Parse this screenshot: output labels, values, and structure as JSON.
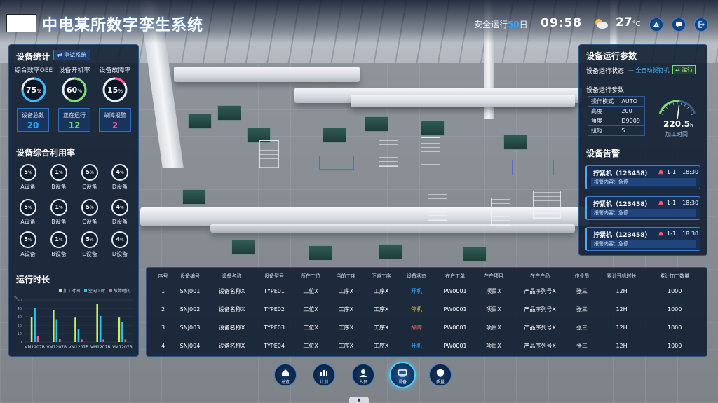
{
  "header": {
    "title": "中电某所数字孪生系统",
    "safe_prefix": "安全运行",
    "safe_days": "50",
    "safe_suffix": "日",
    "time": "09:58",
    "temperature": "27",
    "temp_unit": "°C",
    "buttons": [
      "alert-icon",
      "chat-icon",
      "logout-icon"
    ]
  },
  "stats": {
    "title": "设备统计",
    "tag": "测试系统",
    "metrics": [
      {
        "label": "综合效率OEE",
        "value": 75,
        "unit": "%",
        "color": "#3fb6ff"
      },
      {
        "label": "设备开机率",
        "value": 60,
        "unit": "%",
        "color": "#7ee06a"
      },
      {
        "label": "设备故障率",
        "value": 15,
        "unit": "%",
        "color": "#ff5d8f"
      }
    ],
    "boxes": [
      {
        "label": "设备总数",
        "value": "20",
        "color": "#2ea8ff"
      },
      {
        "label": "正在运行",
        "value": "12",
        "color": "#6de36a"
      },
      {
        "label": "故障报警",
        "value": "2",
        "color": "#ff5d8f"
      }
    ]
  },
  "utilization": {
    "title": "设备综合利用率",
    "rows": [
      [
        {
          "v": "5",
          "n": "A设备"
        },
        {
          "v": "1",
          "n": "B设备"
        },
        {
          "v": "5",
          "n": "C设备"
        },
        {
          "v": "4",
          "n": "D设备"
        }
      ],
      [
        {
          "v": "5",
          "n": "A设备"
        },
        {
          "v": "1",
          "n": "B设备"
        },
        {
          "v": "5",
          "n": "C设备"
        },
        {
          "v": "4",
          "n": "D设备"
        }
      ],
      [
        {
          "v": "5",
          "n": "A设备"
        },
        {
          "v": "1",
          "n": "B设备"
        },
        {
          "v": "5",
          "n": "C设备"
        },
        {
          "v": "4",
          "n": "D设备"
        }
      ]
    ],
    "unit": "%"
  },
  "runtime": {
    "title": "运行时长",
    "legend": [
      {
        "name": "加工时间",
        "color": "#c8f05a"
      },
      {
        "name": "空闲工时",
        "color": "#2ec4f0"
      },
      {
        "name": "故障时间",
        "color": "#ff5d8f"
      }
    ],
    "y_unit": "%",
    "chart_data": {
      "type": "bar",
      "categories": [
        "VM1207B",
        "VM1207B",
        "VM1207B",
        "VM1207B",
        "VM1207B"
      ],
      "ylim": [
        0,
        50
      ],
      "yticks": [
        0,
        10,
        20,
        30,
        40,
        50
      ],
      "series": [
        {
          "name": "加工时间",
          "values": [
            30,
            38,
            29,
            45,
            29
          ]
        },
        {
          "name": "空闲工时",
          "values": [
            40,
            27,
            15,
            31,
            24
          ]
        },
        {
          "name": "故障时间",
          "values": [
            7,
            4,
            3,
            3,
            3
          ]
        }
      ]
    }
  },
  "params": {
    "title": "设备运行参数",
    "status_label": "设备运行状态",
    "device_name": "全自动腿钉机",
    "status_value": "运行",
    "sub_title": "设备运行参数",
    "rows": [
      {
        "k": "操作模式",
        "v": "AUTO"
      },
      {
        "k": "高度",
        "v": "200"
      },
      {
        "k": "角度",
        "v": "D9009"
      },
      {
        "k": "扭矩",
        "v": "5"
      }
    ],
    "gauge_value": "220.5",
    "gauge_unit": "h",
    "gauge_label": "加工时间",
    "gauge_fraction": 0.55
  },
  "alarms": {
    "title": "设备告警",
    "items": [
      {
        "title": "拧紧机（123458）",
        "loc": "1-1",
        "time": "18:30",
        "content": "报警内容：急停"
      },
      {
        "title": "拧紧机（123458）",
        "loc": "1-1",
        "time": "18:30",
        "content": "报警内容：急停"
      },
      {
        "title": "拧紧机（123458）",
        "loc": "1-1",
        "time": "18:30",
        "content": "报警内容：急停"
      }
    ]
  },
  "table": {
    "headers": [
      "序号",
      "设备编号",
      "设备名称",
      "设备型号",
      "所在工位",
      "当前工序",
      "下道工序",
      "设备状态",
      "在产工单",
      "在产项目",
      "在产产品",
      "作业员",
      "累计开机时长",
      "累计加工数量"
    ],
    "rows": [
      [
        "1",
        "SNJ001",
        "设备名称X",
        "TYPE01",
        "工位X",
        "工序X",
        "工序X",
        "开机",
        "PW0001",
        "项目X",
        "产品序列号X",
        "张三",
        "12H",
        "1000"
      ],
      [
        "2",
        "SNJ002",
        "设备名称X",
        "TYPE02",
        "工位X",
        "工序X",
        "工序X",
        "停机",
        "PW0001",
        "项目X",
        "产品序列号X",
        "张三",
        "12H",
        "1000"
      ],
      [
        "3",
        "SNJ003",
        "设备名称X",
        "TYPE03",
        "工位X",
        "工序X",
        "工序X",
        "故障",
        "PW0001",
        "项目X",
        "产品序列号X",
        "张三",
        "12H",
        "1000"
      ],
      [
        "4",
        "SNJ004",
        "设备名称X",
        "TYPE04",
        "工位X",
        "工序X",
        "工序X",
        "开机",
        "PW0001",
        "项目X",
        "产品序列号X",
        "张三",
        "12H",
        "1000"
      ]
    ],
    "status_colors": {
      "开机": "#3fa9ff",
      "停机": "#f2c94c",
      "故障": "#ff5d5d"
    }
  },
  "nav": [
    {
      "label": "总览",
      "icon": "home-icon"
    },
    {
      "label": "计划",
      "icon": "chart-icon"
    },
    {
      "label": "人员",
      "icon": "user-icon"
    },
    {
      "label": "设备",
      "icon": "device-icon",
      "active": true
    },
    {
      "label": "质量",
      "icon": "shield-icon"
    }
  ]
}
